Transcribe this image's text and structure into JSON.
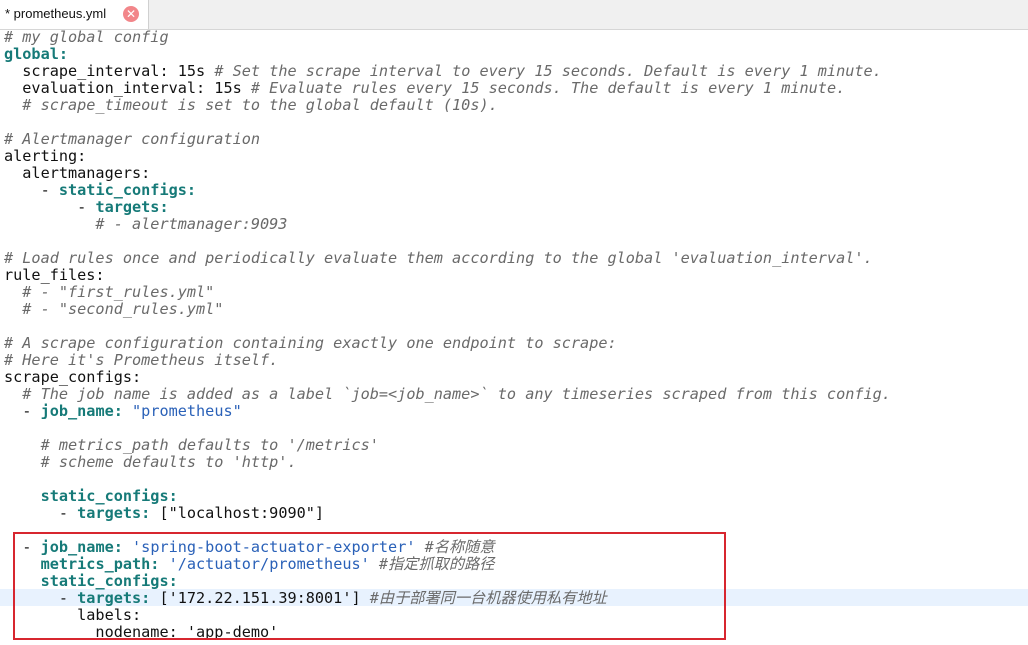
{
  "tab": {
    "title": "* prometheus.yml",
    "close_icon": "close-icon"
  },
  "colors": {
    "comment": "#6a6a6a",
    "key_bold": "#167a78",
    "string": "#2a61b8",
    "annotation_box": "#d7262f",
    "current_line": "#e8f2fe"
  },
  "code": {
    "lines": [
      [
        {
          "t": "# my global config",
          "c": "comment"
        }
      ],
      [
        {
          "t": "global:",
          "c": "bold-key"
        }
      ],
      [
        {
          "t": "  scrape_interval: 15s ",
          "c": "plain"
        },
        {
          "t": "# Set the scrape interval to every 15 seconds. Default is every 1 minute.",
          "c": "comment"
        }
      ],
      [
        {
          "t": "  evaluation_interval: 15s ",
          "c": "plain"
        },
        {
          "t": "# Evaluate rules every 15 seconds. The default is every 1 minute.",
          "c": "comment"
        }
      ],
      [
        {
          "t": "  # scrape_timeout is set to the global default (10s).",
          "c": "comment"
        }
      ],
      [],
      [
        {
          "t": "# Alertmanager configuration",
          "c": "comment"
        }
      ],
      [
        {
          "t": "alerting:",
          "c": "plain"
        }
      ],
      [
        {
          "t": "  alertmanagers:",
          "c": "plain"
        }
      ],
      [
        {
          "t": "    - ",
          "c": "plain"
        },
        {
          "t": "static_configs:",
          "c": "bold-key"
        }
      ],
      [
        {
          "t": "        - ",
          "c": "plain"
        },
        {
          "t": "targets:",
          "c": "bold-key"
        }
      ],
      [
        {
          "t": "          # - alertmanager:9093",
          "c": "comment"
        }
      ],
      [],
      [
        {
          "t": "# Load rules once and periodically evaluate them according to the global 'evaluation_interval'.",
          "c": "comment"
        }
      ],
      [
        {
          "t": "rule_files:",
          "c": "plain"
        }
      ],
      [
        {
          "t": "  # - \"first_rules.yml\"",
          "c": "comment"
        }
      ],
      [
        {
          "t": "  # - \"second_rules.yml\"",
          "c": "comment"
        }
      ],
      [],
      [
        {
          "t": "# A scrape configuration containing exactly one endpoint to scrape:",
          "c": "comment"
        }
      ],
      [
        {
          "t": "# Here it's Prometheus itself.",
          "c": "comment"
        }
      ],
      [
        {
          "t": "scrape_configs:",
          "c": "plain"
        }
      ],
      [
        {
          "t": "  # The job name is added as a label `job=<job_name>` to any timeseries scraped from this config.",
          "c": "comment"
        }
      ],
      [
        {
          "t": "  - ",
          "c": "plain"
        },
        {
          "t": "job_name:",
          "c": "bold-key"
        },
        {
          "t": " ",
          "c": "plain"
        },
        {
          "t": "\"prometheus\"",
          "c": "str"
        }
      ],
      [],
      [
        {
          "t": "    # metrics_path defaults to '/metrics'",
          "c": "comment"
        }
      ],
      [
        {
          "t": "    # scheme defaults to 'http'.",
          "c": "comment"
        }
      ],
      [],
      [
        {
          "t": "    ",
          "c": "plain"
        },
        {
          "t": "static_configs:",
          "c": "bold-key"
        }
      ],
      [
        {
          "t": "      - ",
          "c": "plain"
        },
        {
          "t": "targets:",
          "c": "bold-key"
        },
        {
          "t": " [\"localhost:9090\"]",
          "c": "plain"
        }
      ],
      [],
      [
        {
          "t": "  - ",
          "c": "plain"
        },
        {
          "t": "job_name:",
          "c": "bold-key"
        },
        {
          "t": " ",
          "c": "plain"
        },
        {
          "t": "'spring-boot-actuator-exporter'",
          "c": "str"
        },
        {
          "t": " #名称随意",
          "c": "comment"
        }
      ],
      [
        {
          "t": "    ",
          "c": "plain"
        },
        {
          "t": "metrics_path:",
          "c": "bold-key"
        },
        {
          "t": " ",
          "c": "plain"
        },
        {
          "t": "'/actuator/prometheus'",
          "c": "str"
        },
        {
          "t": " #指定抓取的路径",
          "c": "comment"
        }
      ],
      [
        {
          "t": "    ",
          "c": "plain"
        },
        {
          "t": "static_configs:",
          "c": "bold-key"
        }
      ],
      [
        {
          "t": "      - ",
          "c": "plain"
        },
        {
          "t": "targets:",
          "c": "bold-key"
        },
        {
          "t": " ['172.22.151.39:8001'] ",
          "c": "plain"
        },
        {
          "t": "#由于部署同一台机器使用私有地址",
          "c": "comment"
        }
      ],
      [
        {
          "t": "        labels:",
          "c": "plain"
        }
      ],
      [
        {
          "t": "          nodename: 'app-demo'",
          "c": "plain"
        }
      ]
    ]
  }
}
